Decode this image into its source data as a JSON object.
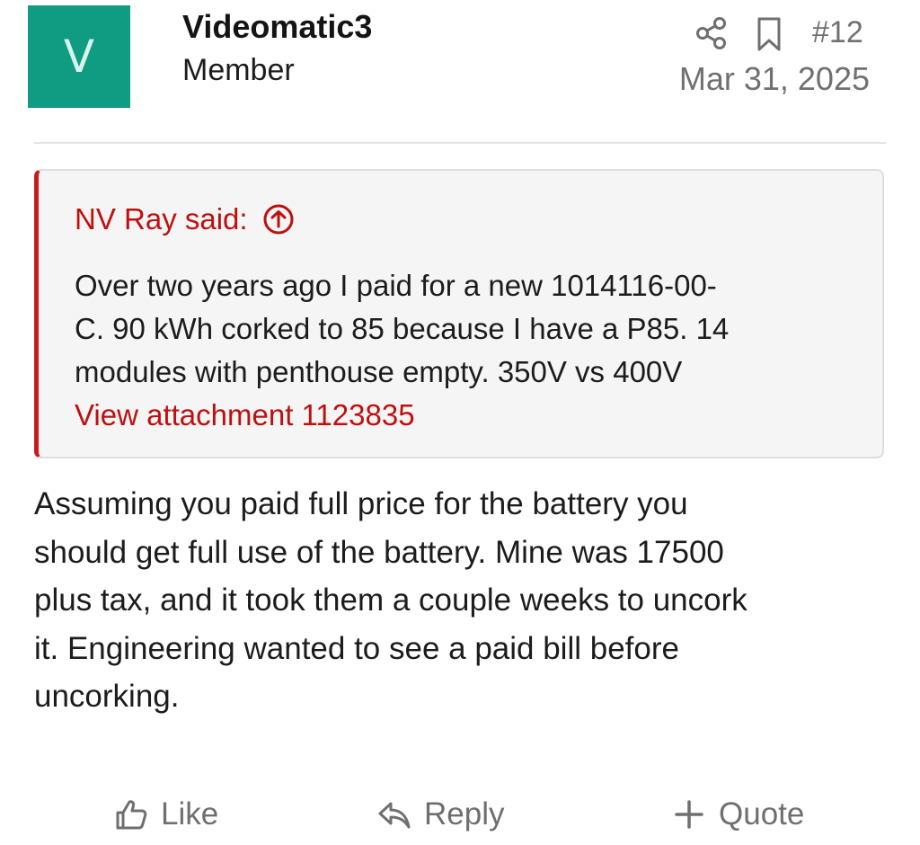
{
  "post": {
    "avatar_letter": "V",
    "username": "Videomatic3",
    "role": "Member",
    "number": "#12",
    "date": "Mar 31, 2025",
    "avatar_color": "#0f9c82"
  },
  "quote": {
    "author": "NV Ray said:",
    "lines": [
      "Over two years ago I paid for a new 1014116-00-",
      "C. 90 kWh corked to 85 because I have a P85. 14",
      "modules with penthouse empty. 350V vs 400V"
    ],
    "attachment": "View attachment 1123835",
    "accent_color": "#c81c1c"
  },
  "body": {
    "lines": [
      "Assuming you paid full price for the battery you",
      "should get full use of the battery. Mine was 17500",
      "plus tax, and it took them a couple weeks to uncork",
      "it. Engineering wanted to see a paid bill before",
      "uncorking."
    ]
  },
  "actions": {
    "like": "Like",
    "reply": "Reply",
    "quote": "Quote"
  },
  "icons": {
    "share": "share-icon",
    "bookmark": "bookmark-icon",
    "quote_source": "arrow-up-circle-icon",
    "like": "thumbs-up-icon",
    "reply": "reply-arrow-icon",
    "quote": "plus-icon"
  }
}
